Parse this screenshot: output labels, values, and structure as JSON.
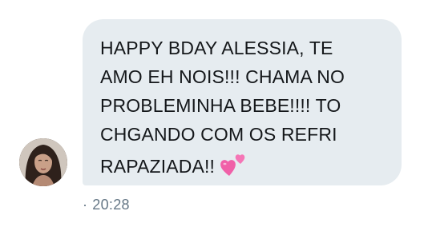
{
  "message": {
    "lines": [
      "HAPPY BDAY ALESSIA, TE",
      "AMO EH NOIS!!! CHAMA NO",
      "PROBLEMINHA BEBE!!!! TO",
      "CHGANDO COM OS REFRI",
      "RAPAZIADA!!"
    ],
    "emoji": "two-hearts-emoji",
    "timestamp_separator": "·",
    "timestamp": "20:28"
  },
  "colors": {
    "bubble": "#e6ecf0",
    "text": "#14171a",
    "meta": "#657786",
    "heart": "#f060a8"
  }
}
